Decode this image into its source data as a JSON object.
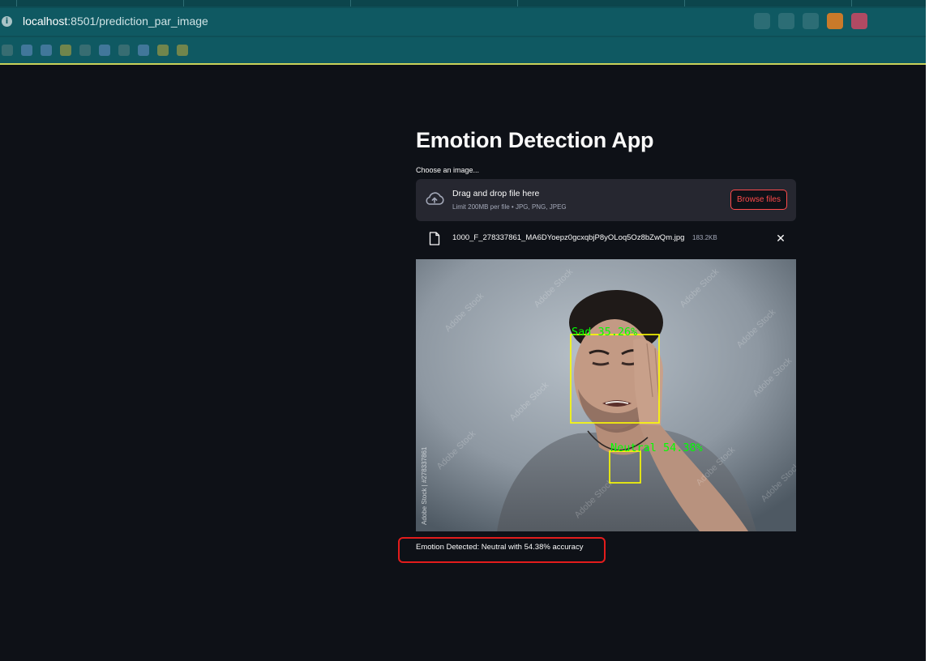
{
  "browser": {
    "url_host": "localhost",
    "url_rest": ":8501/prediction_par_image"
  },
  "app": {
    "title": "Emotion Detection App",
    "uploader_label": "Choose an image...",
    "dropzone": {
      "title": "Drag and drop file here",
      "subtitle": "Limit 200MB per file • JPG, PNG, JPEG",
      "browse_label": "Browse files"
    },
    "file": {
      "name": "1000_F_278337861_MA6DYoepz0gcxqbjP8yOLoq5Oz8bZwQm.jpg",
      "size": "183.2KB"
    },
    "image": {
      "detections": [
        {
          "label": "Sad 35.26%"
        },
        {
          "label": "Neutral 54.38%"
        }
      ],
      "side_caption": "Adobe Stock | #278337861",
      "watermark": "Adobe Stock",
      "box_color": "#ffff00",
      "label_color": "#00ff00"
    },
    "result": "Emotion Detected: Neutral with 54.38% accuracy"
  },
  "colors": {
    "background": "#0e1117",
    "accent": "#ff4b4b",
    "highlight_border": "#e31c1c"
  }
}
